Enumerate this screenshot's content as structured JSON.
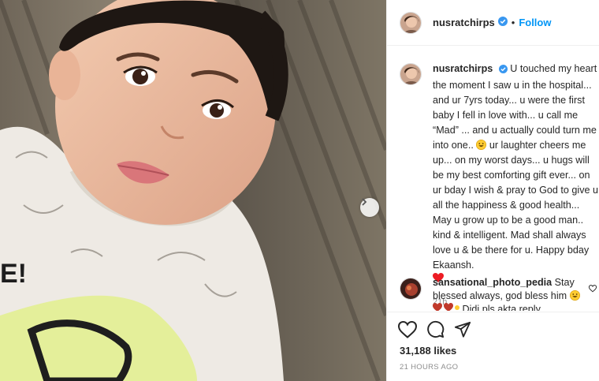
{
  "post": {
    "username": "nusratchirps",
    "follow_label": "Follow",
    "dot": "•",
    "caption_p1": "U touched my heart the moment I saw u in the hospital... and ur 7yrs today... u were the first baby I fell in love with... u call me “Mad” ... and u actually could turn me into one..",
    "caption_p2": "ur laughter cheers me up... on my worst days... u hugs will be my best comforting gift ever... on ur bday I wish & pray to God to give u all the happiness & good health... May u grow up to be a good man.. kind & intelligent. Mad shall always love u & be there for u. Happy bday Ekaansh.",
    "caption_time": "21h",
    "likes": "31,188 likes",
    "posted_ago": "21 HOURS AGO"
  },
  "comment": {
    "username": "sansational_photo_pedia",
    "text": "Stay blessed always, god bless him",
    "text2": "Didi pls akta reply"
  },
  "colors": {
    "accent": "#0095f6",
    "verified": "#3897f0",
    "heart": "#ed4956"
  },
  "icons": {
    "like": "heart-icon",
    "comment": "comment-icon",
    "share": "share-icon",
    "next": "chevron-right-icon"
  }
}
